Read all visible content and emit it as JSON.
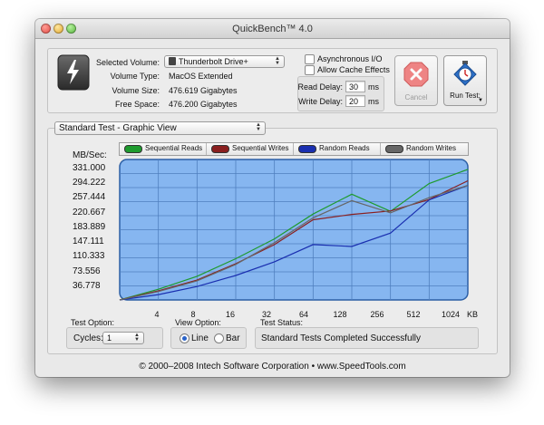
{
  "window": {
    "title": "QuickBench™ 4.0"
  },
  "volume": {
    "selected_label": "Selected Volume:",
    "selected_value": "Thunderbolt Drive+",
    "type_label": "Volume Type:",
    "type_value": "MacOS Extended",
    "size_label": "Volume Size:",
    "size_value": "476.619 Gigabytes",
    "free_label": "Free Space:",
    "free_value": "476.200 Gigabytes"
  },
  "options": {
    "async_label": "Asynchronous I/O",
    "async_checked": false,
    "cache_label": "Allow Cache Effects",
    "cache_checked": false,
    "read_delay_label": "Read Delay:",
    "read_delay_value": "30",
    "write_delay_label": "Write Delay:",
    "write_delay_value": "20",
    "unit_ms": "ms"
  },
  "buttons": {
    "cancel_label": "Cancel",
    "run_label": "Run Test:"
  },
  "view": {
    "mode_value": "Standard Test - Graphic View"
  },
  "chart_data": {
    "type": "line",
    "ylabel": "MB/Sec:",
    "xunit": "KB",
    "y_ticks": [
      "331.000",
      "294.222",
      "257.444",
      "220.667",
      "183.889",
      "147.111",
      "110.333",
      "73.556",
      "36.778"
    ],
    "x": [
      "4",
      "8",
      "16",
      "32",
      "64",
      "128",
      "256",
      "512",
      "1024"
    ],
    "ylim": [
      0,
      367.78
    ],
    "plot_bg": "#86b6f0",
    "grid": true,
    "legend_position": "top",
    "series": [
      {
        "name": "Sequential Reads",
        "color": "#1e9b2e",
        "values": [
          0,
          28,
          62,
          108,
          160,
          225,
          277,
          232,
          305,
          342
        ]
      },
      {
        "name": "Sequential Writes",
        "color": "#8a1f1f",
        "values": [
          0,
          24,
          52,
          95,
          145,
          210,
          224,
          233,
          263,
          312
        ]
      },
      {
        "name": "Random Reads",
        "color": "#1a2fb0",
        "values": [
          0,
          14,
          35,
          64,
          100,
          145,
          140,
          175,
          262,
          300
        ]
      },
      {
        "name": "Random Writes",
        "color": "#666666",
        "values": [
          0,
          22,
          50,
          93,
          150,
          215,
          260,
          228,
          268,
          300
        ]
      }
    ]
  },
  "bottom": {
    "test_option_label": "Test Option:",
    "cycles_label": "Cycles:",
    "cycles_value": "1",
    "view_option_label": "View Option:",
    "line_label": "Line",
    "bar_label": "Bar",
    "line_selected": true,
    "status_label": "Test Status:",
    "status_value": "Standard Tests Completed Successfully"
  },
  "footer": {
    "copyright": "© 2000–2008 Intech Software Corporation • www.SpeedTools.com"
  }
}
